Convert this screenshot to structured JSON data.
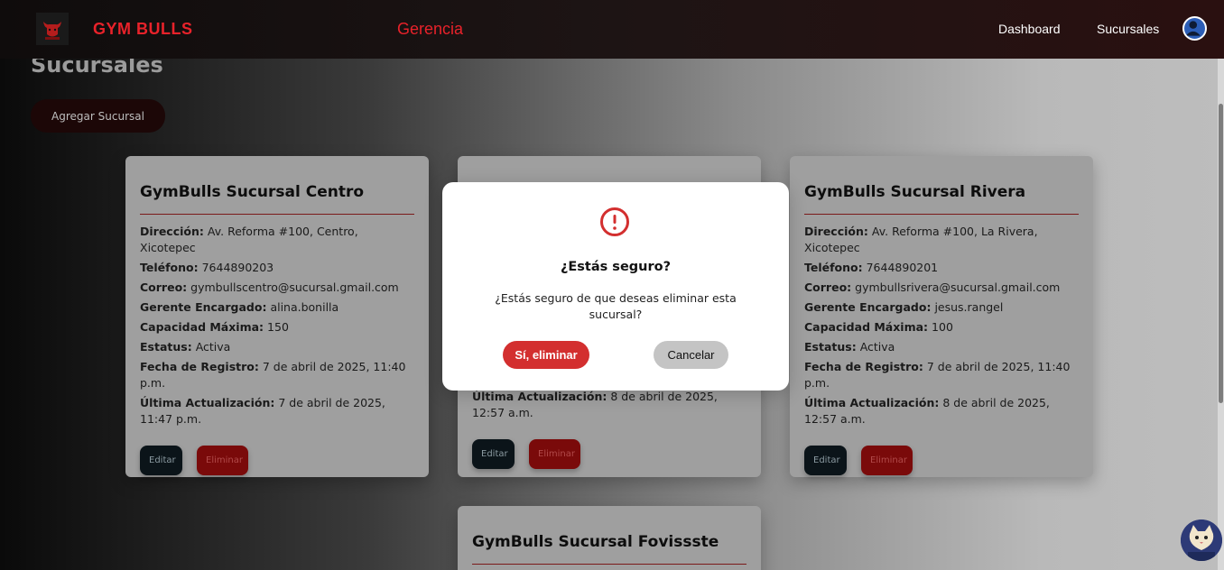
{
  "navbar": {
    "brand": "GYM BULLS",
    "center_title": "Gerencia",
    "links": [
      "Dashboard",
      "Sucursales"
    ],
    "logo_icon": "bull-logo-icon",
    "avatar_icon": "user-icon"
  },
  "page": {
    "title": "Sucursales",
    "add_button": "Agregar Sucursal"
  },
  "cards": [
    {
      "title": "GymBulls Sucursal Centro",
      "rows": [
        {
          "label": "Dirección:",
          "value": "Av. Reforma #100, Centro, Xicotepec"
        },
        {
          "label": "Teléfono:",
          "value": "7644890203"
        },
        {
          "label": "Correo:",
          "value": "gymbullscentro@sucursal.gmail.com"
        },
        {
          "label": "Gerente Encargado:",
          "value": "alina.bonilla"
        },
        {
          "label": "Capacidad Máxima:",
          "value": "150"
        },
        {
          "label": "Estatus:",
          "value": "Activa"
        },
        {
          "label": "Fecha de Registro:",
          "value": "7 de abril de 2025, 11:40 p.m."
        },
        {
          "label": "Última Actualización:",
          "value": "7 de abril de 2025, 11:47 p.m."
        }
      ],
      "edit": "Editar",
      "delete": "Eliminar"
    },
    {
      "title": "",
      "rows": [
        {
          "label": "Última Actualización:",
          "value": "8 de abril de 2025, 12:57 a.m."
        }
      ],
      "edit": "Editar",
      "delete": "Eliminar"
    },
    {
      "title": "GymBulls Sucursal Rivera",
      "rows": [
        {
          "label": "Dirección:",
          "value": "Av. Reforma #100, La Rivera, Xicotepec"
        },
        {
          "label": "Teléfono:",
          "value": "7644890201"
        },
        {
          "label": "Correo:",
          "value": "gymbullsrivera@sucursal.gmail.com"
        },
        {
          "label": "Gerente Encargado:",
          "value": "jesus.rangel"
        },
        {
          "label": "Capacidad Máxima:",
          "value": "100"
        },
        {
          "label": "Estatus:",
          "value": "Activa"
        },
        {
          "label": "Fecha de Registro:",
          "value": "7 de abril de 2025, 11:40 p.m."
        },
        {
          "label": "Última Actualización:",
          "value": "8 de abril de 2025, 12:57 a.m."
        }
      ],
      "edit": "Editar",
      "delete": "Eliminar"
    },
    {
      "title": "GymBulls Sucursal Fovissste"
    }
  ],
  "modal": {
    "icon": "alert-circle-icon",
    "title": "¿Estás seguro?",
    "text": "¿Estás seguro de que deseas eliminar esta sucursal?",
    "confirm": "Sí, eliminar",
    "cancel": "Cancelar"
  },
  "colors": {
    "accent": "#e8222a",
    "confirm": "#d32f2f"
  }
}
